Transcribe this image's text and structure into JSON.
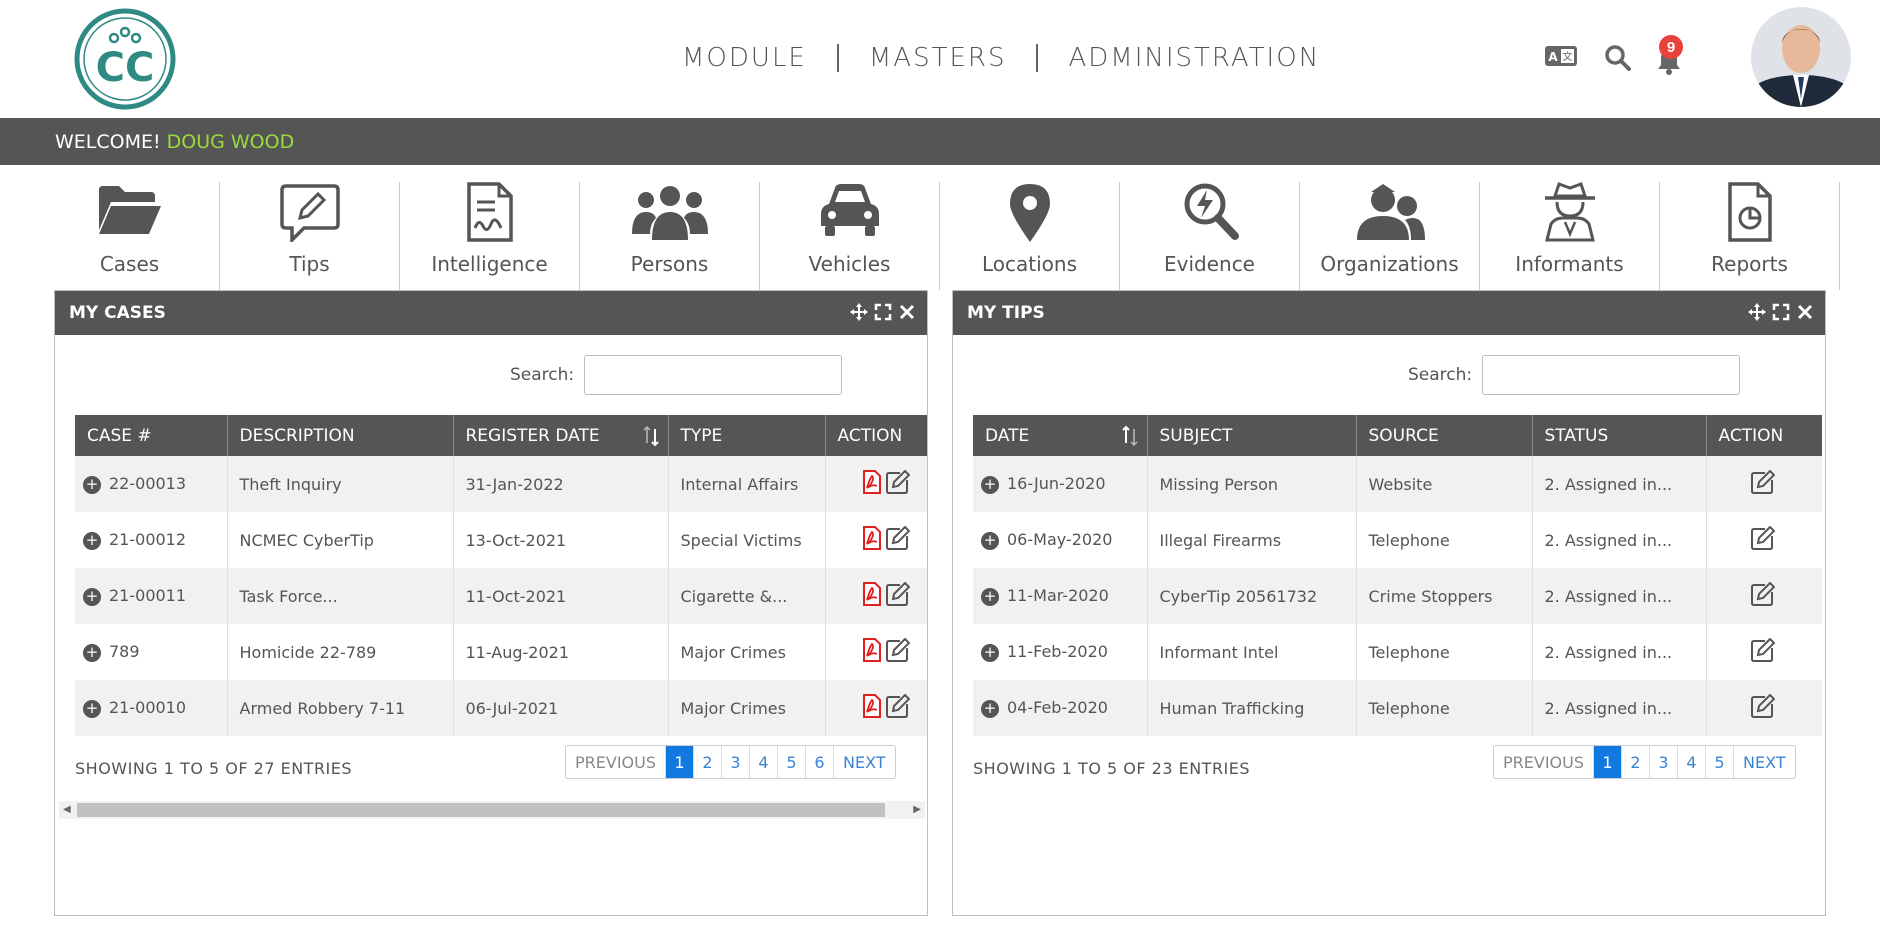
{
  "header": {
    "logo_text": "CC",
    "nav": [
      {
        "label": "MODULE"
      },
      {
        "label": "MASTERS"
      },
      {
        "label": "ADMINISTRATION"
      }
    ],
    "notification_count": "9"
  },
  "welcome": {
    "prefix": "WELCOME!",
    "user_name": "DOUG WOOD"
  },
  "modules": [
    {
      "label": "Cases",
      "icon": "folder-open-icon"
    },
    {
      "label": "Tips",
      "icon": "pencil-bubble-icon"
    },
    {
      "label": "Intelligence",
      "icon": "document-signature-icon"
    },
    {
      "label": "Persons",
      "icon": "users-icon"
    },
    {
      "label": "Vehicles",
      "icon": "car-icon"
    },
    {
      "label": "Locations",
      "icon": "map-pin-icon"
    },
    {
      "label": "Evidence",
      "icon": "search-bolt-icon"
    },
    {
      "label": "Organizations",
      "icon": "group-icon"
    },
    {
      "label": "Informants",
      "icon": "spy-icon"
    },
    {
      "label": "Reports",
      "icon": "report-chart-icon"
    }
  ],
  "my_cases": {
    "title": "MY CASES",
    "search_label": "Search:",
    "search_value": "",
    "columns": [
      "CASE #",
      "DESCRIPTION",
      "REGISTER DATE",
      "TYPE",
      "ACTION"
    ],
    "rows": [
      {
        "case": "22-00013",
        "description": "Theft Inquiry",
        "date": "31-Jan-2022",
        "type": "Internal Affairs"
      },
      {
        "case": "21-00012",
        "description": "NCMEC CyberTip",
        "date": "13-Oct-2021",
        "type": "Special Victims"
      },
      {
        "case": "21-00011",
        "description": "Task Force...",
        "date": "11-Oct-2021",
        "type": "Cigarette &..."
      },
      {
        "case": "789",
        "description": "Homicide 22-789",
        "date": "11-Aug-2021",
        "type": "Major Crimes"
      },
      {
        "case": "21-00010",
        "description": "Armed Robbery 7-11",
        "date": "06-Jul-2021",
        "type": "Major Crimes"
      }
    ],
    "showing": "SHOWING 1 TO 5 OF 27 ENTRIES",
    "pager": {
      "previous": "PREVIOUS",
      "pages": [
        "1",
        "2",
        "3",
        "4",
        "5",
        "6"
      ],
      "active": "1",
      "next": "NEXT"
    }
  },
  "my_tips": {
    "title": "MY TIPS",
    "search_label": "Search:",
    "search_value": "",
    "columns": [
      "DATE",
      "SUBJECT",
      "SOURCE",
      "STATUS",
      "ACTION"
    ],
    "rows": [
      {
        "date": "16-Jun-2020",
        "subject": "Missing Person",
        "source": "Website",
        "status": "2. Assigned in..."
      },
      {
        "date": "06-May-2020",
        "subject": "Illegal Firearms",
        "source": "Telephone",
        "status": "2. Assigned in..."
      },
      {
        "date": "11-Mar-2020",
        "subject": "CyberTip 20561732",
        "source": "Crime Stoppers",
        "status": "2. Assigned in..."
      },
      {
        "date": "11-Feb-2020",
        "subject": "Informant Intel",
        "source": "Telephone",
        "status": "2. Assigned in..."
      },
      {
        "date": "04-Feb-2020",
        "subject": "Human Trafficking",
        "source": "Telephone",
        "status": "2. Assigned in..."
      }
    ],
    "showing": "SHOWING 1 TO 5 OF 23 ENTRIES",
    "pager": {
      "previous": "PREVIOUS",
      "pages": [
        "1",
        "2",
        "3",
        "4",
        "5"
      ],
      "active": "1",
      "next": "NEXT"
    }
  },
  "colors": {
    "bar": "#555555",
    "accent_green": "#9bdc3c",
    "logo_teal": "#2f8a84",
    "pager_active": "#1279e0",
    "pdf_red": "#e02020"
  }
}
